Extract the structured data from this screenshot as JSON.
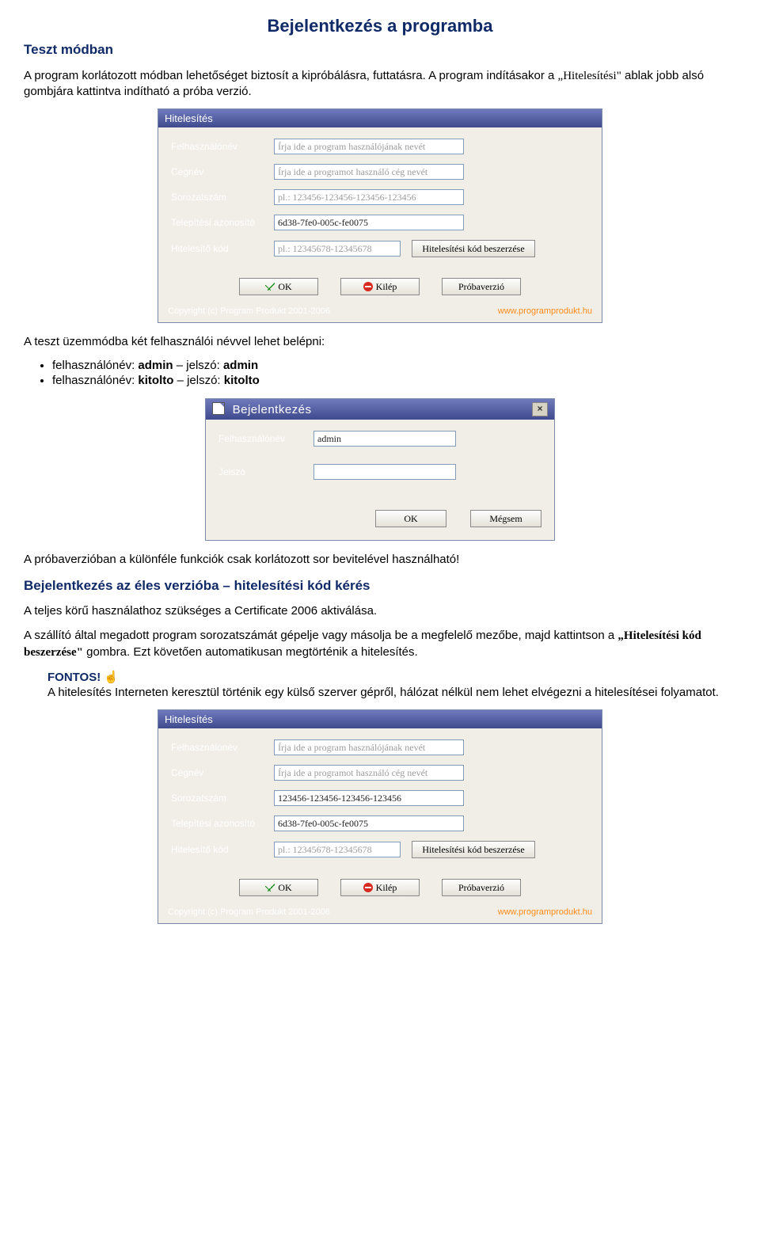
{
  "doc": {
    "title": "Bejelentkezés a programba",
    "test_mode_heading": "Teszt módban",
    "intro_1a": "A program korlátozott módban lehetőséget biztosít a kipróbálásra, futtatásra. A program indításakor a ",
    "intro_1b": "„Hitelesítési\"",
    "intro_1c": " ablak jobb alsó gombjára kattintva indítható a próba verzió.",
    "users_intro": "A teszt üzemmódba két felhasználói névvel lehet belépni:",
    "user1_a": "felhasználónév: ",
    "user1_b": "admin",
    "user1_c": " – jelszó: ",
    "user1_d": "admin",
    "user2_a": "felhasználónév: ",
    "user2_b": "kitolto",
    "user2_c": " – jelszó: ",
    "user2_d": "kitolto",
    "proba_line": "A próbaverzióban a különféle funkciók csak korlátozott sor bevitelével használható!",
    "live_heading": "Bejelentkezés az éles verzióba – hitelesítési kód kérés",
    "cert_line": "A teljes körű használathoz szükséges a Certificate 2006 aktiválása.",
    "serial_a": "A szállító által megadott program sorozatszámát gépelje vagy másolja be a megfelelő mezőbe, majd kattintson a ",
    "serial_b": "„Hitelesítési kód beszerzése\"",
    "serial_c": " gombra. Ezt követően automatikusan megtörténik a hitelesítés.",
    "fontos": "FONTOS!",
    "fontos_hand": "☝",
    "fontos_txt": "A hitelesítés Interneten keresztül történik egy külső szerver gépről, hálózat nélkül nem lehet elvégezni a hitelesítései folyamatot."
  },
  "dlg1": {
    "title": "Hitelesítés",
    "labels": {
      "user": "Felhasználónév",
      "company": "Cégnév",
      "serial": "Sorozatszám",
      "install": "Telepítési azonosító",
      "code": "Hitelesítő kód"
    },
    "placeholders": {
      "user": "Írja ide a program használójának nevét",
      "company": "Írja ide a programot használó cég nevét",
      "serial": "pl.: 123456-123456-123456-123456",
      "code": "pl.: 12345678-12345678"
    },
    "install_value": "6d38-7fe0-005c-fe0075",
    "buttons": {
      "get_code": "Hitelesítési kód beszerzése",
      "ok": "OK",
      "exit": "Kilép",
      "trial": "Próbaverzió"
    },
    "copyright": "Copyright (c) Program Produkt 2001-2006",
    "url": "www.programprodukt.hu"
  },
  "dlg2": {
    "title": "Bejelentkezés",
    "labels": {
      "user": "Felhasználónév",
      "pass": "Jelszó"
    },
    "user_value": "admin",
    "buttons": {
      "ok": "OK",
      "cancel": "Mégsem"
    }
  },
  "dlg3": {
    "title": "Hitelesítés",
    "labels": {
      "user": "Felhasználónév",
      "company": "Cégnév",
      "serial": "Sorozatszám",
      "install": "Telepítési azonosító",
      "code": "Hitelesítő kód"
    },
    "placeholders": {
      "user": "Írja ide a program használójának nevét",
      "company": "Írja ide a programot használó cég nevét",
      "code": "pl.: 12345678-12345678"
    },
    "serial_value": "123456-123456-123456-123456",
    "install_value": "6d38-7fe0-005c-fe0075",
    "buttons": {
      "get_code": "Hitelesítési kód beszerzése",
      "ok": "OK",
      "exit": "Kilép",
      "trial": "Próbaverzió"
    },
    "copyright": "Copyright (c) Program Produkt 2001-2006",
    "url": "www.programprodukt.hu"
  }
}
